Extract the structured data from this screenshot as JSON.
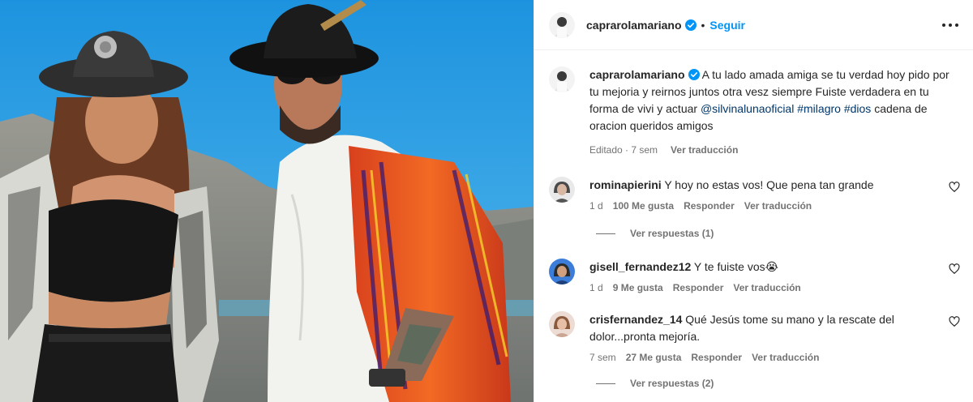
{
  "header": {
    "username": "caprarolamariano",
    "separator": "•",
    "follow_label": "Seguir",
    "verified_icon": "verified-badge-icon",
    "more_icon": "more-options-icon"
  },
  "caption": {
    "username": "caprarolamariano",
    "text": "A tu lado amada amiga se tu verdad hoy pido por tu mejoria y reirnos juntos otra vesz siempre Fuiste verdadera en tu forma de vivi y actuar",
    "mention": "@silvinalunaoficial",
    "hashtag1": "#milagro",
    "hashtag2": "#dios",
    "tail": "cadena de oracion queridos amigos",
    "edited": "Editado · 7 sem",
    "translate": "Ver traducción"
  },
  "comments": [
    {
      "username": "rominapierini",
      "text": "Y hoy no estas vos! Que pena tan grande",
      "time": "1 d",
      "likes": "100 Me gusta",
      "reply": "Responder",
      "translate": "Ver traducción",
      "replies": "Ver respuestas (1)"
    },
    {
      "username": "gisell_fernandez12",
      "text": "Y te fuiste vos😭",
      "time": "1 d",
      "likes": "9 Me gusta",
      "reply": "Responder",
      "translate": "Ver traducción"
    },
    {
      "username": "crisfernandez_14",
      "text": "Qué Jesús tome su mano y la rescate del dolor...pronta mejoría.",
      "time": "7 sem",
      "likes": "27 Me gusta",
      "reply": "Responder",
      "translate": "Ver traducción",
      "replies": "Ver respuestas (2)"
    }
  ],
  "colors": {
    "link": "#00376b",
    "follow": "#0095f6",
    "muted": "#737373",
    "sky": "#2a9fe0"
  }
}
